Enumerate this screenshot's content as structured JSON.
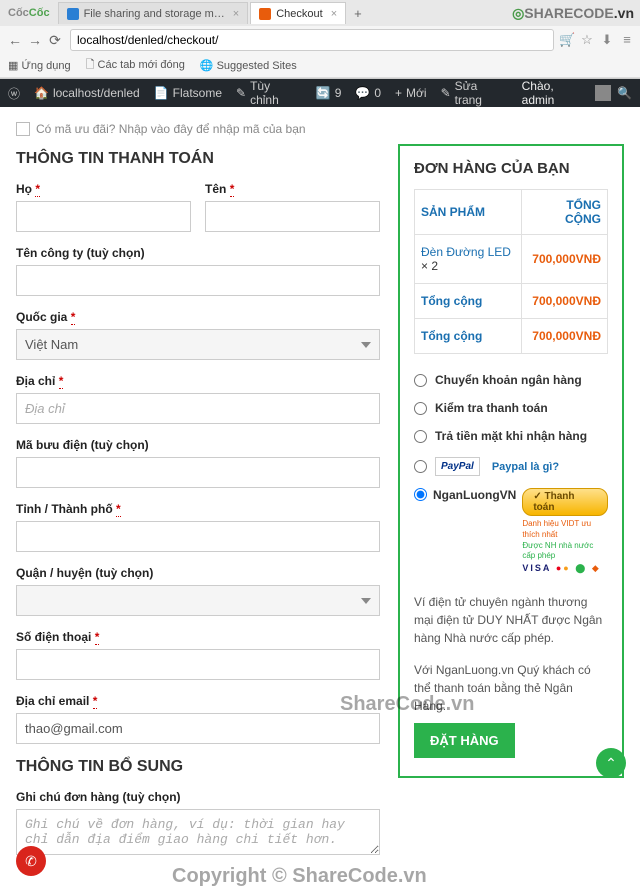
{
  "browser": {
    "logo_part1": "Cốc",
    "logo_part2": "Cốc",
    "tab1_title": "File sharing and storage m…",
    "tab2_title": "Checkout",
    "url": "localhost/denled/checkout/",
    "bm_apps": "Ứng dụng",
    "bm_newtabs": "Các tab mới đóng",
    "bm_suggested": "Suggested Sites",
    "sharecode": "SHARECODE",
    "sharecode_tld": ".vn"
  },
  "wp": {
    "site": "localhost/denled",
    "theme": "Flatsome",
    "customize": "Tùy chỉnh",
    "updates": "9",
    "comments": "0",
    "new": "Mới",
    "editpage": "Sửa trang",
    "greeting": "Chào, admin"
  },
  "coupon_hint": "Có mã ưu đãi? Nhập vào đây để nhập mã của bạn",
  "billing": {
    "heading": "THÔNG TIN THANH TOÁN",
    "firstname": "Họ",
    "lastname": "Tên",
    "company": "Tên công ty (tuỳ chọn)",
    "country": "Quốc gia",
    "country_val": "Việt Nam",
    "address": "Địa chỉ",
    "address_ph": "Địa chỉ",
    "postcode": "Mã bưu điện (tuỳ chọn)",
    "city": "Tỉnh / Thành phố",
    "district": "Quận / huyện (tuỳ chọn)",
    "phone": "Số điện thoại",
    "email": "Địa chỉ email",
    "email_val": "thao@gmail.com"
  },
  "additional": {
    "heading": "THÔNG TIN BỔ SUNG",
    "notes_label": "Ghi chú đơn hàng (tuỳ chọn)",
    "notes_ph": "Ghi chú về đơn hàng, ví dụ: thời gian hay chỉ dẫn địa điểm giao hàng chi tiết hơn."
  },
  "order": {
    "heading": "ĐƠN HÀNG CỦA BẠN",
    "th_product": "SẢN PHẨM",
    "th_total": "TỔNG CỘNG",
    "item_name": "Đèn Đường LED",
    "item_qty": "× 2",
    "item_total": "700,000VNĐ",
    "subtotal_label": "Tổng cộng",
    "subtotal": "700,000VNĐ",
    "total_label": "Tổng cộng",
    "total": "700,000VNĐ"
  },
  "pay": {
    "bank": "Chuyển khoản ngân hàng",
    "check": "Kiểm tra thanh toán",
    "cod": "Trả tiền mặt khi nhận hàng",
    "paypal_what": "Paypal là gì?",
    "nl_label": "NganLuongVN",
    "nl_btn": "Thanh toán",
    "nl_tag1": "Danh hiệu VIDT ưu thích nhất",
    "nl_tag2": "Được NH nhà nước cấp phép",
    "note1": "Ví điện tử chuyên ngành thương mại điện tử DUY NHẤT được Ngân hàng Nhà nước cấp phép.",
    "note2": "Với NganLuong.vn Quý khách có thể thanh toán bằng thẻ Ngân Hàng.",
    "place": "ĐẶT HÀNG"
  },
  "wm": {
    "t1": "ShareCode.vn",
    "t2": "Copyright © ShareCode.vn"
  }
}
